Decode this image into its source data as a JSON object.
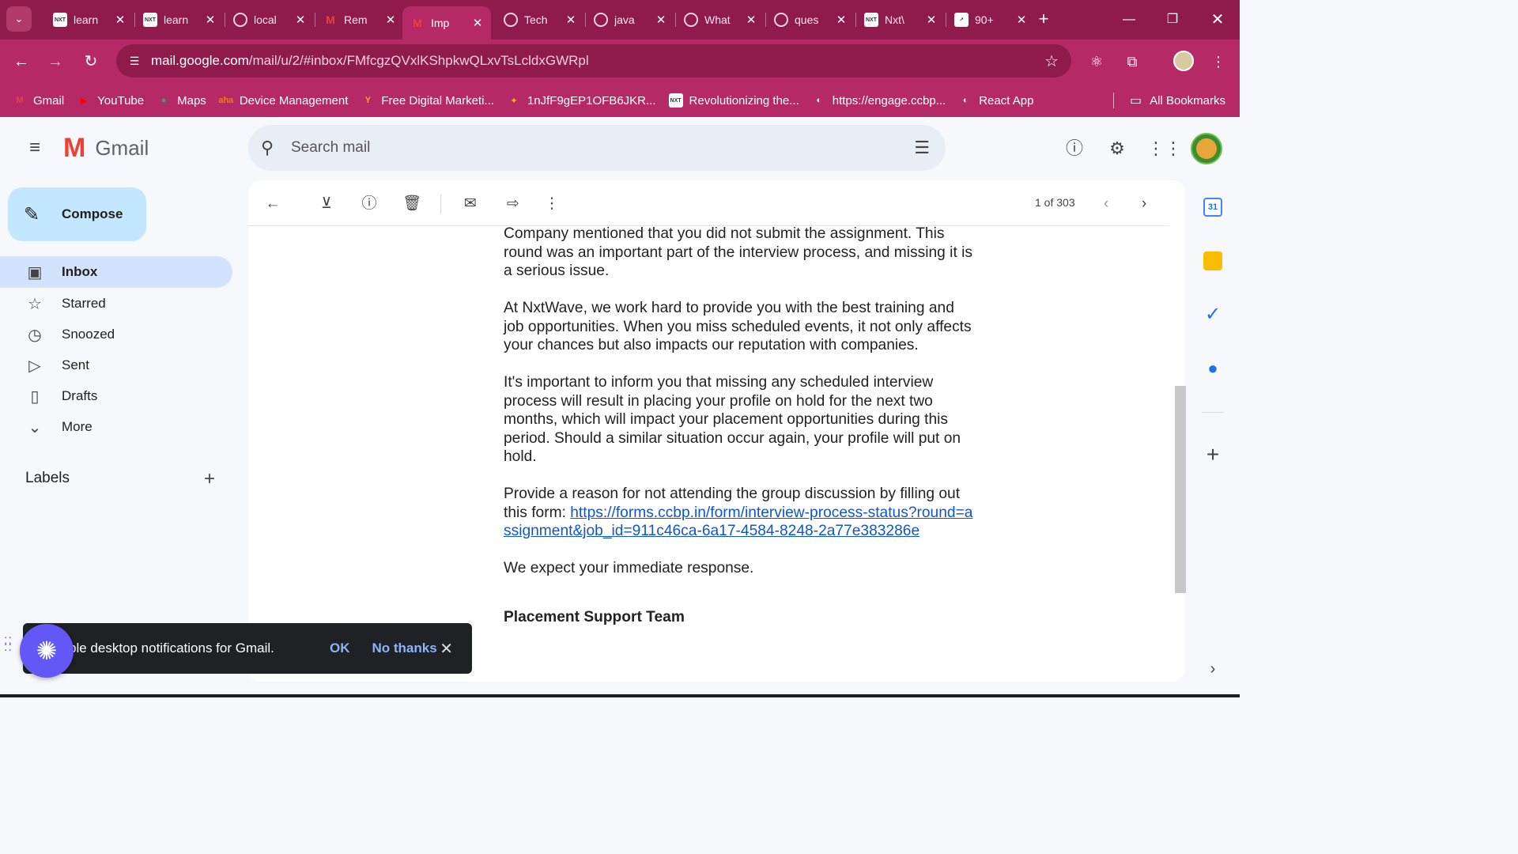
{
  "browser": {
    "tabs": [
      {
        "title": "learn",
        "icon": "nxtwave-favicon",
        "favicon_text": "NXT"
      },
      {
        "title": "learn",
        "icon": "nxtwave-favicon",
        "favicon_text": "NXT"
      },
      {
        "title": "local",
        "icon": "chatgpt-favicon"
      },
      {
        "title": "Rem",
        "icon": "gmail-favicon"
      },
      {
        "title": "Imp",
        "icon": "gmail-favicon",
        "active": true
      },
      {
        "title": "Tech",
        "icon": "chatgpt-favicon"
      },
      {
        "title": "java",
        "icon": "github-favicon"
      },
      {
        "title": "What",
        "icon": "web-favicon"
      },
      {
        "title": "ques",
        "icon": "google-favicon"
      },
      {
        "title": "Nxt\\",
        "icon": "nxtwave-favicon",
        "favicon_text": "NXT"
      },
      {
        "title": "90+",
        "icon": "chart-favicon"
      }
    ],
    "url_domain": "mail.google.com",
    "url_path": "/mail/u/2/#inbox/FMfcgzQVxlKShpkwQLxvTsLcldxGWRpl",
    "bookmarks": [
      {
        "label": "Gmail",
        "icon": "gmail-icon",
        "color": "#ea4335",
        "glyph": "M"
      },
      {
        "label": "YouTube",
        "icon": "youtube-icon",
        "color": "#ff0000",
        "glyph": "▶"
      },
      {
        "label": "Maps",
        "icon": "maps-icon",
        "color": "#34a853",
        "glyph": "●"
      },
      {
        "label": "Device Management",
        "icon": "aha-icon",
        "color": "#f57c00",
        "glyph": "aha"
      },
      {
        "label": "Free Digital Marketi...",
        "icon": "yoast-icon",
        "color": "#f9a825",
        "glyph": "Y"
      },
      {
        "label": "1nJfF9gEP1OFB6JKR...",
        "icon": "pinwheel-icon",
        "color": "#fbbc04",
        "glyph": "✦"
      },
      {
        "label": "Revolutionizing the...",
        "icon": "nxtwave-favicon",
        "color": "#ffffff",
        "glyph": "NXT"
      },
      {
        "label": "https://engage.ccbp...",
        "icon": "globe-icon",
        "color": "#ffffff",
        "glyph": "◐"
      },
      {
        "label": "React App",
        "icon": "globe-icon",
        "color": "#ffffff",
        "glyph": "◐"
      }
    ],
    "all_bookmarks": "All Bookmarks"
  },
  "gmail": {
    "brand": "Gmail",
    "search_placeholder": "Search mail",
    "compose": "Compose",
    "nav": [
      {
        "label": "Inbox",
        "icon": "inbox-icon",
        "glyph": "▣",
        "active": true
      },
      {
        "label": "Starred",
        "icon": "star-icon",
        "glyph": "☆"
      },
      {
        "label": "Snoozed",
        "icon": "clock-icon",
        "glyph": "◷"
      },
      {
        "label": "Sent",
        "icon": "send-icon",
        "glyph": "▷"
      },
      {
        "label": "Drafts",
        "icon": "draft-icon",
        "glyph": "▯"
      },
      {
        "label": "More",
        "icon": "chevron-down-icon",
        "glyph": "⌄"
      }
    ],
    "labels_title": "Labels",
    "pager": "1 of 303",
    "message": {
      "paragraphs": [
        "Company mentioned that you did not submit the assignment. This round was an important part of the interview process, and missing it is a serious issue.",
        "At NxtWave, we work hard to provide you with the best training and job opportunities. When you miss scheduled events, it not only affects your chances but also impacts our reputation with companies.",
        "It's important to inform you that missing any scheduled interview process will result in placing your profile on hold for the next two months, which will impact your placement opportunities during this period. Should a similar situation occur again, your profile will put on hold."
      ],
      "form_prefix": "Provide a reason for not attending the group discussion by filling out this form: ",
      "form_link": "https://forms.ccbp.in/form/interview-process-status?round=assignment&job_id=911c46ca-6a17-4584-8248-2a77e383286e",
      "closing": "We expect your immediate response.",
      "signature": "Placement Support Team"
    },
    "snackbar": {
      "text": "ble desktop notifications for Gmail.",
      "ok": "OK",
      "no_thanks": "No thanks"
    },
    "side_panel": {
      "calendar_day": "31"
    }
  }
}
